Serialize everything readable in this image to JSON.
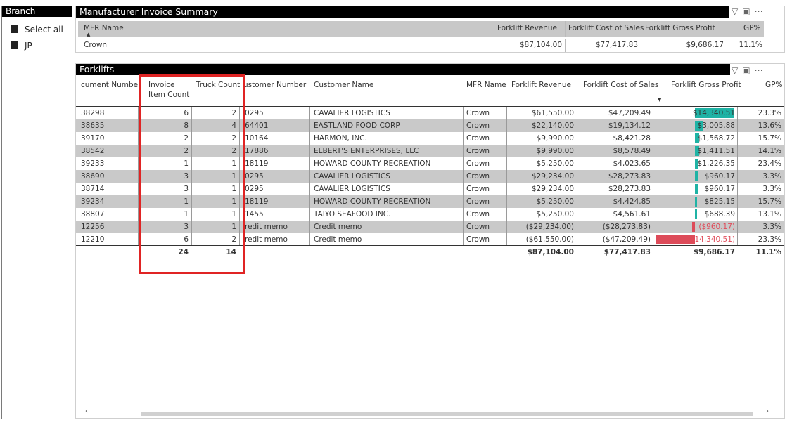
{
  "branch": {
    "title": "Branch",
    "items": [
      {
        "label": "Select all"
      },
      {
        "label": "JP"
      }
    ]
  },
  "summary": {
    "title": "Manufacturer Invoice Summary",
    "columns": [
      "MFR Name",
      "Forklift Revenue",
      "Forklift Cost of Sales",
      "Forklift Gross Profit",
      "GP%"
    ],
    "row": {
      "mfr": "Crown",
      "revenue": "$87,104.00",
      "cost": "$77,417.83",
      "profit": "$9,686.17",
      "gp": "11.1%"
    }
  },
  "forklifts": {
    "title": "Forklifts",
    "columns": {
      "doc": "cument Number",
      "invoice_l1": "Invoice",
      "invoice_l2": "Item Count",
      "truck": "Truck Count",
      "custnum": "ustomer Number",
      "custname": "Customer Name",
      "mfr": "MFR Name",
      "revenue": "Forklift Revenue",
      "cost": "Forklift Cost of Sales",
      "profit": "Forklift Gross Profit",
      "gp": "GP%"
    },
    "rows": [
      {
        "doc": "38298",
        "inv": "6",
        "truck": "2",
        "custnum": "0295",
        "custname": "CAVALIER LOGISTICS",
        "mfr": "Crown",
        "revenue": "$61,550.00",
        "cost": "$47,209.49",
        "profit": "$14,340.51",
        "profit_value": 14340.51,
        "gp": "23.3%"
      },
      {
        "doc": "38635",
        "inv": "8",
        "truck": "4",
        "custnum": "64401",
        "custname": "EASTLAND FOOD CORP",
        "mfr": "Crown",
        "revenue": "$22,140.00",
        "cost": "$19,134.12",
        "profit": "$3,005.88",
        "profit_value": 3005.88,
        "gp": "13.6%"
      },
      {
        "doc": "39170",
        "inv": "2",
        "truck": "2",
        "custnum": "10164",
        "custname": "HARMON, INC.",
        "mfr": "Crown",
        "revenue": "$9,990.00",
        "cost": "$8,421.28",
        "profit": "$1,568.72",
        "profit_value": 1568.72,
        "gp": "15.7%"
      },
      {
        "doc": "38542",
        "inv": "2",
        "truck": "2",
        "custnum": "17886",
        "custname": "ELBERT'S ENTERPRISES, LLC",
        "mfr": "Crown",
        "revenue": "$9,990.00",
        "cost": "$8,578.49",
        "profit": "$1,411.51",
        "profit_value": 1411.51,
        "gp": "14.1%"
      },
      {
        "doc": "39233",
        "inv": "1",
        "truck": "1",
        "custnum": "18119",
        "custname": "HOWARD COUNTY RECREATION",
        "mfr": "Crown",
        "revenue": "$5,250.00",
        "cost": "$4,023.65",
        "profit": "$1,226.35",
        "profit_value": 1226.35,
        "gp": "23.4%"
      },
      {
        "doc": "38690",
        "inv": "3",
        "truck": "1",
        "custnum": "0295",
        "custname": "CAVALIER LOGISTICS",
        "mfr": "Crown",
        "revenue": "$29,234.00",
        "cost": "$28,273.83",
        "profit": "$960.17",
        "profit_value": 960.17,
        "gp": "3.3%"
      },
      {
        "doc": "38714",
        "inv": "3",
        "truck": "1",
        "custnum": "0295",
        "custname": "CAVALIER LOGISTICS",
        "mfr": "Crown",
        "revenue": "$29,234.00",
        "cost": "$28,273.83",
        "profit": "$960.17",
        "profit_value": 960.17,
        "gp": "3.3%"
      },
      {
        "doc": "39234",
        "inv": "1",
        "truck": "1",
        "custnum": "18119",
        "custname": "HOWARD COUNTY RECREATION",
        "mfr": "Crown",
        "revenue": "$5,250.00",
        "cost": "$4,424.85",
        "profit": "$825.15",
        "profit_value": 825.15,
        "gp": "15.7%"
      },
      {
        "doc": "38807",
        "inv": "1",
        "truck": "1",
        "custnum": "1455",
        "custname": "TAIYO SEAFOOD INC.",
        "mfr": "Crown",
        "revenue": "$5,250.00",
        "cost": "$4,561.61",
        "profit": "$688.39",
        "profit_value": 688.39,
        "gp": "13.1%"
      },
      {
        "doc": "12256",
        "inv": "3",
        "truck": "1",
        "custnum": "redit memo",
        "custname": "Credit memo",
        "mfr": "Crown",
        "revenue": "($29,234.00)",
        "cost": "($28,273.83)",
        "profit": "($960.17)",
        "profit_value": -960.17,
        "gp": "3.3%"
      },
      {
        "doc": "12210",
        "inv": "6",
        "truck": "2",
        "custnum": "redit memo",
        "custname": "Credit memo",
        "mfr": "Crown",
        "revenue": "($61,550.00)",
        "cost": "($47,209.49)",
        "profit": "$14,340.51)",
        "profit_value": -14340.51,
        "gp": "23.3%"
      }
    ],
    "total": {
      "inv": "24",
      "truck": "14",
      "revenue": "$87,104.00",
      "cost": "$77,417.83",
      "profit": "$9,686.17",
      "gp": "11.1%"
    }
  },
  "colors": {
    "positive_bar": "#1fb3a5",
    "negative_bar": "#dd4b59",
    "highlight": "#e02424",
    "row_alt": "#c9c9c9"
  },
  "icons": [
    "filter-icon",
    "focus-mode-icon",
    "more-options-icon",
    "sort-ascending-icon",
    "sort-descending-icon",
    "scroll-left-icon",
    "scroll-right-icon"
  ]
}
